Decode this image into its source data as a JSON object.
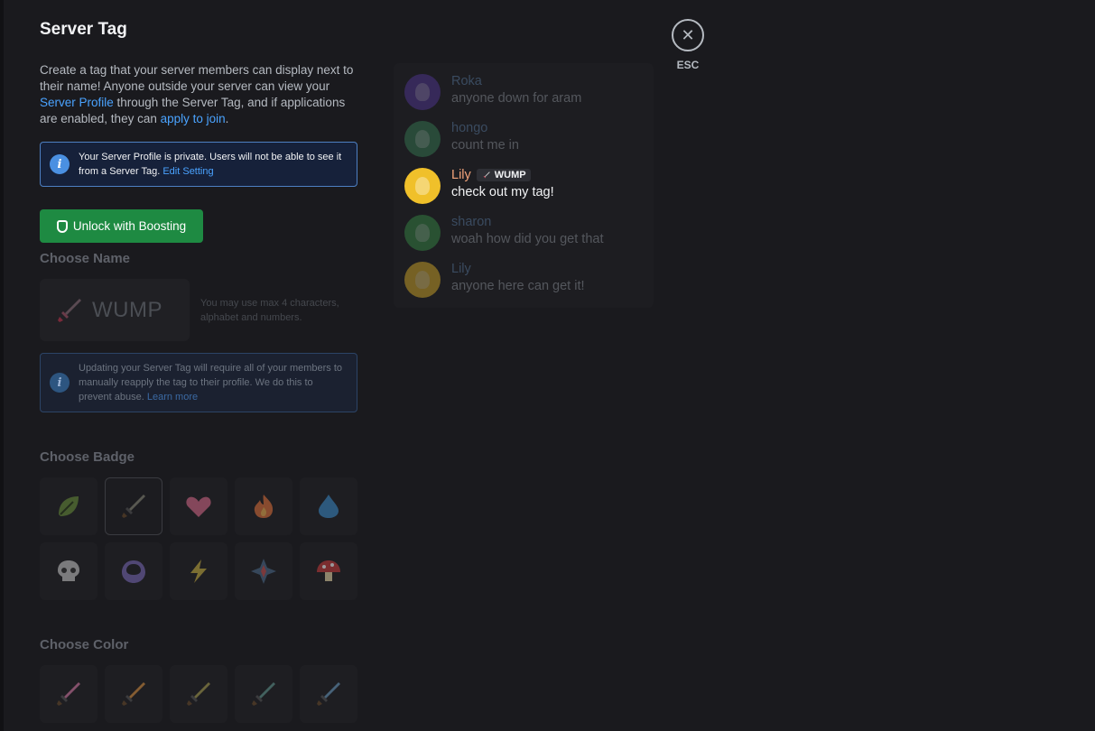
{
  "header": {
    "title": "Server Tag",
    "esc_label": "ESC"
  },
  "description": {
    "part1": "Create a tag that your server members can display next to their name! Anyone outside your server can view your ",
    "profile_link": "Server Profile",
    "part2": " through the Server Tag, and if applications are enabled, they can ",
    "join_link": "apply to join",
    "part3": "."
  },
  "private_notice": {
    "text": "Your Server Profile is private. Users will not be able to see it from a Server Tag. ",
    "link": "Edit Setting"
  },
  "boost_button": {
    "label": "Unlock with Boosting"
  },
  "choose_name": {
    "label": "Choose Name",
    "value": "WUMP",
    "hint": "You may use max 4 characters, alphabet and numbers."
  },
  "update_notice": {
    "text": "Updating your Server Tag will require all of your members to manually reapply the tag to their profile. We do this to prevent abuse. ",
    "link": "Learn more"
  },
  "choose_badge": {
    "label": "Choose Badge",
    "badges": [
      {
        "icon": "leaf-icon",
        "color": "#6a8f3a"
      },
      {
        "icon": "sword-icon",
        "color": "#8a8a7a",
        "selected": true
      },
      {
        "icon": "heart-icon",
        "color": "#d96a8a"
      },
      {
        "icon": "fire-icon",
        "color": "#e0703a"
      },
      {
        "icon": "water-drop-icon",
        "color": "#3a8ac8"
      },
      {
        "icon": "skull-icon",
        "color": "#c8c8c8"
      },
      {
        "icon": "moon-icon",
        "color": "#7a6ab8"
      },
      {
        "icon": "lightning-icon",
        "color": "#c8b040"
      },
      {
        "icon": "diamond-star-icon",
        "color": "#c85050"
      },
      {
        "icon": "mushroom-icon",
        "color": "#c83a3a"
      }
    ]
  },
  "choose_color": {
    "label": "Choose Color",
    "swords": [
      {
        "icon": "sword-pink-icon",
        "color": "#d87aa8"
      },
      {
        "icon": "sword-orange-icon",
        "color": "#d89040"
      },
      {
        "icon": "sword-olive-icon",
        "color": "#a8a050"
      },
      {
        "icon": "sword-teal-icon",
        "color": "#609890"
      },
      {
        "icon": "sword-blue-icon",
        "color": "#6a9ac0"
      }
    ]
  },
  "preview": {
    "messages": [
      {
        "author": "Roka",
        "text": "anyone down for aram",
        "avatar_color": "#5a3aa8",
        "dim": true
      },
      {
        "author": "hongo",
        "text": "count me in",
        "avatar_color": "#3a8a5a",
        "dim": true
      },
      {
        "author": "Lily",
        "text": "check out my tag!",
        "avatar_color": "#f0c02a",
        "tag": "WUMP",
        "author_color": "#f2a37a",
        "dim": false
      },
      {
        "author": "sharon",
        "text": "woah how did you get that",
        "avatar_color": "#3a9a4a",
        "dim": true
      },
      {
        "author": "Lily",
        "text": "anyone here can get it!",
        "avatar_color": "#f0c02a",
        "dim": true
      }
    ]
  }
}
